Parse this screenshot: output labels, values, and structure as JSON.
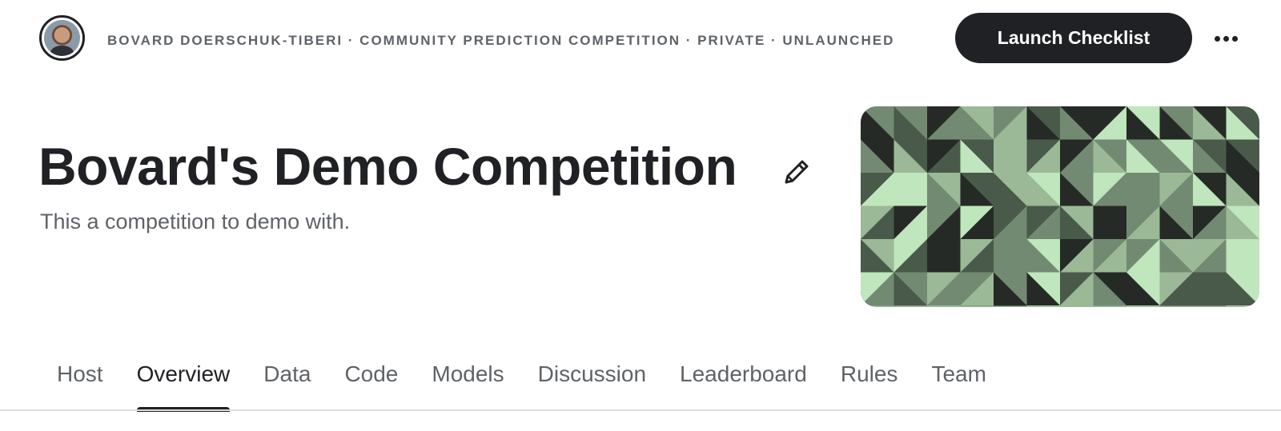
{
  "header": {
    "breadcrumb": "Bovard Doerschuk-Tiberi · Community Prediction Competition · Private · Unlaunched",
    "launch_label": "Launch Checklist",
    "more_icon": "more-horizontal-icon"
  },
  "competition": {
    "title": "Bovard's Demo Competition",
    "subtitle": "This a competition to demo with.",
    "edit_icon": "pencil-icon"
  },
  "tabs": [
    {
      "label": "Host",
      "active": false
    },
    {
      "label": "Overview",
      "active": true
    },
    {
      "label": "Data",
      "active": false
    },
    {
      "label": "Code",
      "active": false
    },
    {
      "label": "Models",
      "active": false
    },
    {
      "label": "Discussion",
      "active": false
    },
    {
      "label": "Leaderboard",
      "active": false
    },
    {
      "label": "Rules",
      "active": false
    },
    {
      "label": "Team",
      "active": false
    }
  ],
  "colors": {
    "dark": "#202124",
    "muted": "#5f6368",
    "banner_palette": [
      "#262a26",
      "#4a5a4a",
      "#738a72",
      "#9bb996",
      "#bfe6bc"
    ]
  }
}
